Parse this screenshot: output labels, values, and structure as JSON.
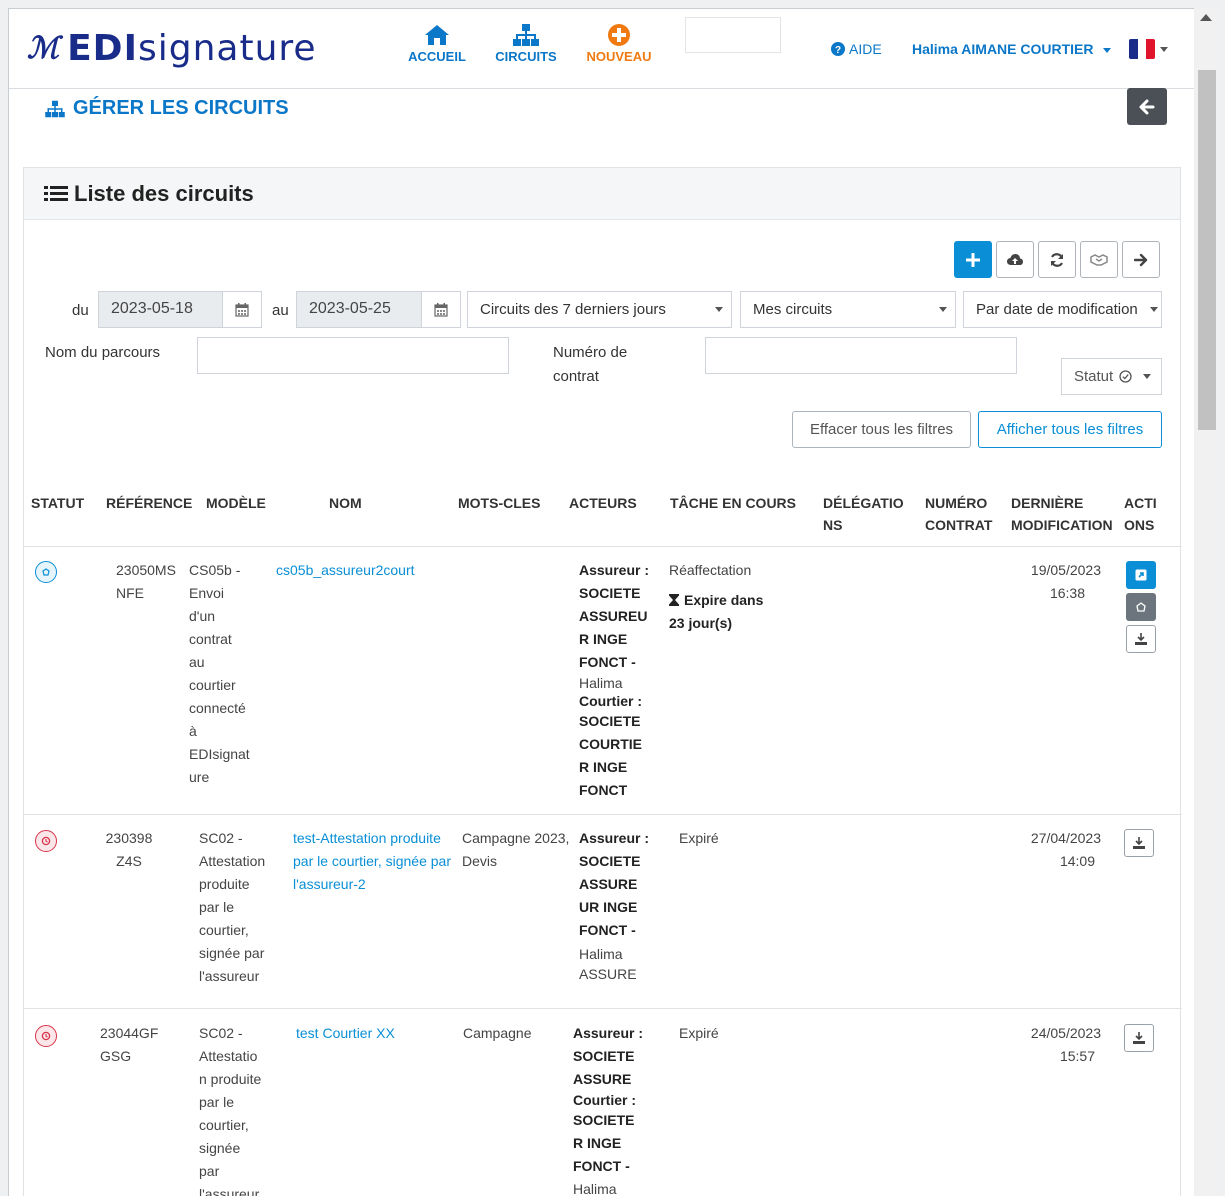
{
  "nav": {
    "brand_edi": "EDI",
    "brand_signature": "signature",
    "accueil": "ACCUEIL",
    "circuits": "CIRCUITS",
    "nouveau": "NOUVEAU",
    "aide": "AIDE",
    "user": "Halima AIMANE COURTIER",
    "language": "Français"
  },
  "page": {
    "title": "GÉRER LES CIRCUITS"
  },
  "panel": {
    "title": "Liste des circuits"
  },
  "filters": {
    "du_label": "du",
    "date_from": "2023-05-18",
    "au_label": "au",
    "date_to": "2023-05-25",
    "period": "Circuits des 7 derniers jours",
    "owner": "Mes circuits",
    "sort": "Par date de modification",
    "nom_parcours_label": "Nom du parcours",
    "nom_parcours_value": "",
    "numero_contrat_label_1": "Numéro de",
    "numero_contrat_label_2": "contrat",
    "numero_contrat_value": "",
    "statut": "Statut",
    "clear_all": "Effacer tous les filtres",
    "show_all": "Afficher tous les filtres"
  },
  "table": {
    "headers": {
      "statut": "STATUT",
      "reference": "RÉFÉRENCE",
      "modele": "MODÈLE",
      "nom": "NOM",
      "mots_cles": "MOTS-CLES",
      "acteurs": "ACTEURS",
      "tache_en_cours": "TÂCHE EN COURS",
      "delegations_1": "DÉLÉGATIO",
      "delegations_2": "NS",
      "numero_contrat_1": "NUMÉRO",
      "numero_contrat_2": "CONTRAT",
      "derniere_modif_1": "DERNIÈRE",
      "derniere_modif_2": "MODIFICATION",
      "actions_1": "ACTI",
      "actions_2": "ONS"
    },
    "rows": [
      {
        "ref_1": "23050MS",
        "ref_2": "NFE",
        "modele": [
          "CS05b -",
          "Envoi",
          "d'un",
          "contrat",
          "au",
          "courtier",
          "connecté",
          "à",
          "EDIsignat",
          "ure"
        ],
        "nom": "cs05b_assureur2court",
        "mots_cles": "",
        "acteurs": {
          "a1_role": "Assureur :",
          "a1_org": [
            "SOCIETE",
            "ASSUREU",
            "R INGE",
            "FONCT -"
          ],
          "a1_person": "Halima",
          "a2_role": "Courtier :",
          "a2_org": [
            "SOCIETE",
            "COURTIE",
            "R INGE",
            "FONCT"
          ]
        },
        "tache": "Réaffectation",
        "expire_1": "Expire dans",
        "expire_2": "23 jour(s)",
        "date": "19/05/2023",
        "time": "16:38"
      },
      {
        "ref_1": "230398",
        "ref_2": "Z4S",
        "modele": [
          "SC02 -",
          "Attestation",
          "produite",
          "par le",
          "courtier,",
          "signée par",
          "l'assureur"
        ],
        "nom": [
          "test-Attestation produite",
          "par le courtier, signée par",
          "l'assureur-2"
        ],
        "mots_cles": [
          "Campagne 2023,",
          "Devis"
        ],
        "acteurs": {
          "a1_role": "Assureur :",
          "a1_org": [
            "SOCIETE",
            "ASSURE",
            "UR INGE",
            "FONCT -"
          ],
          "a1_person": "Halima",
          "a1_person_2": "ASSURE"
        },
        "tache": "Expiré",
        "date": "27/04/2023",
        "time": "14:09"
      },
      {
        "ref_1": "23044GF",
        "ref_2": "GSG",
        "modele": [
          "SC02 -",
          "Attestatio",
          "n produite",
          "par le",
          "courtier,",
          "signée",
          "par",
          "l'assureur"
        ],
        "nom": "test Courtier XX",
        "mots_cles": "Campagne",
        "acteurs": {
          "a1_role": "Assureur :",
          "a1_org": [
            "SOCIETE",
            "ASSURE"
          ],
          "a2_role": "Courtier :",
          "a2_org": [
            "SOCIETE",
            "R INGE",
            "FONCT -"
          ],
          "a2_person": "Halima"
        },
        "tache": "Expiré",
        "date": "24/05/2023",
        "time": "15:57"
      }
    ]
  },
  "colors": {
    "primary_blue": "#0a8fd6",
    "brand_navy": "#1a2c8a",
    "nouveau_orange": "#f07a12",
    "status_active": "#0a8fd6",
    "status_expired": "#d9344a"
  }
}
